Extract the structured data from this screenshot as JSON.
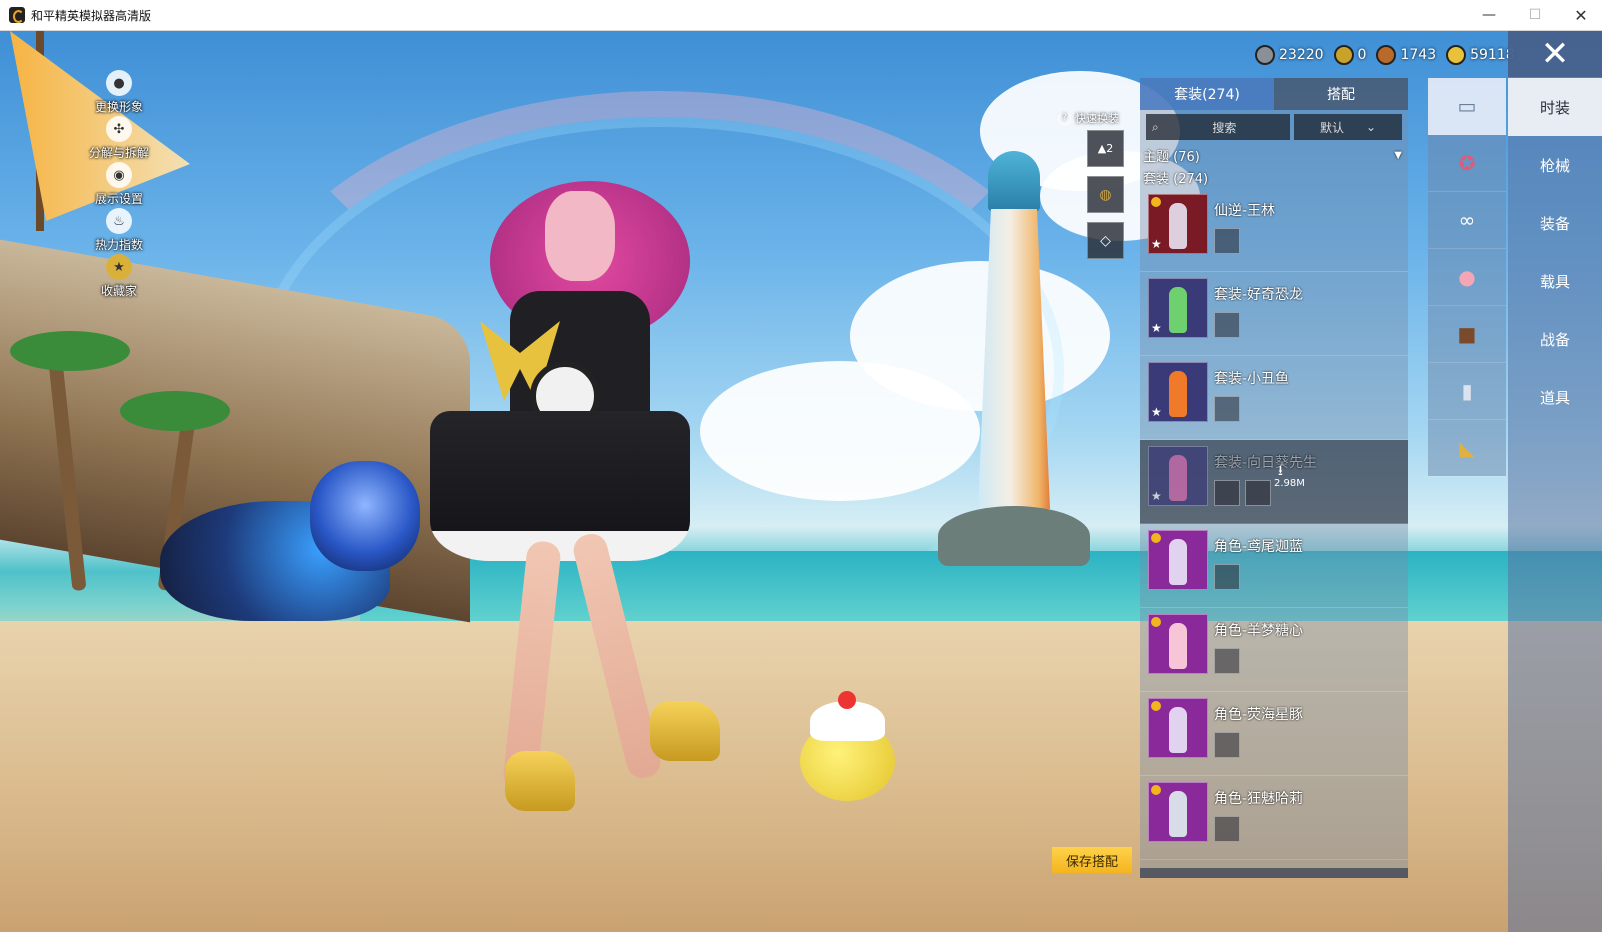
{
  "window": {
    "title": "和平精英模拟器高清版",
    "min": "—",
    "max": "☐",
    "close": "✕"
  },
  "left_menu": [
    {
      "label": "更换形象",
      "icon": "person-icon"
    },
    {
      "label": "分解与拆解",
      "icon": "gear-icon"
    },
    {
      "label": "展示设置",
      "icon": "eye-icon"
    },
    {
      "label": "热力指数",
      "icon": "flame-icon"
    },
    {
      "label": "收藏家",
      "icon": "medal-icon"
    }
  ],
  "currencies": [
    {
      "value": "23220",
      "color": "#8a8f98"
    },
    {
      "value": "0",
      "color": "#c9a22a"
    },
    {
      "value": "1743",
      "color": "#b86a2a"
    },
    {
      "value": "59118",
      "color": "#e8c23a"
    }
  ],
  "quick_change": {
    "label": "快速换装",
    "slot_count": "2"
  },
  "save_button": "保存搭配",
  "panel": {
    "tabs": [
      "套装(274)",
      "搭配"
    ],
    "search_placeholder": "搜索",
    "sort_label": "默认",
    "section_theme": "主题 (76)",
    "section_sets": "套装 (274)",
    "download_size": "2.98M",
    "items": [
      {
        "name": "仙逆-王林",
        "thumb_color": "#7a1a24"
      },
      {
        "name": "套装-好奇恐龙",
        "thumb_color": "#3a3a78"
      },
      {
        "name": "套装-小丑鱼",
        "thumb_color": "#3a3a78"
      },
      {
        "name": "套装-向日葵先生",
        "thumb_color": "#3a3a78"
      },
      {
        "name": "角色-鸢尾迦蓝",
        "thumb_color": "#8a2a9a"
      },
      {
        "name": "角色-羊梦糖心",
        "thumb_color": "#8a2a9a"
      },
      {
        "name": "角色-荧海星豚",
        "thumb_color": "#8a2a9a"
      },
      {
        "name": "角色-狂魅哈莉",
        "thumb_color": "#8a2a9a"
      }
    ]
  },
  "icon_column": [
    "outfit-icon",
    "motorcycle-icon",
    "glasses-icon",
    "pig-mask-icon",
    "jacket-icon",
    "pants-icon",
    "shoes-icon"
  ],
  "categories": [
    "时装",
    "枪械",
    "装备",
    "载具",
    "战备",
    "道具"
  ]
}
